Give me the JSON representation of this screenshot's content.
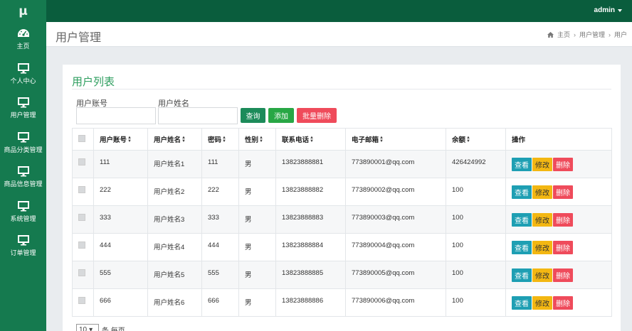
{
  "app": {
    "logo": "μ",
    "user": "admin"
  },
  "sidebar": {
    "items": [
      {
        "label": "主页",
        "icon": "dashboard-gauge-icon"
      },
      {
        "label": "个人中心",
        "icon": "monitor-icon"
      },
      {
        "label": "用户管理",
        "icon": "monitor-icon"
      },
      {
        "label": "商品分类管理",
        "icon": "monitor-icon"
      },
      {
        "label": "商品信息管理",
        "icon": "monitor-icon"
      },
      {
        "label": "系统管理",
        "icon": "monitor-icon"
      },
      {
        "label": "订单管理",
        "icon": "monitor-icon"
      }
    ]
  },
  "header": {
    "title": "用户管理",
    "breadcrumb": [
      "主页",
      "用户管理",
      "用户"
    ]
  },
  "card": {
    "title": "用户列表",
    "search": {
      "account_label": "用户账号",
      "account_value": "",
      "name_label": "用户姓名",
      "name_value": ""
    },
    "buttons": {
      "query": "查询",
      "add": "添加",
      "batch_delete": "批量删除"
    }
  },
  "table": {
    "columns": [
      "用户账号",
      "用户姓名",
      "密码",
      "性别",
      "联系电话",
      "电子邮箱",
      "余额",
      "操作"
    ],
    "rows": [
      {
        "account": "111",
        "name": "用户姓名1",
        "password": "111",
        "gender": "男",
        "phone": "13823888881",
        "email": "773890001@qq.com",
        "balance": "426424992"
      },
      {
        "account": "222",
        "name": "用户姓名2",
        "password": "222",
        "gender": "男",
        "phone": "13823888882",
        "email": "773890002@qq.com",
        "balance": "100"
      },
      {
        "account": "333",
        "name": "用户姓名3",
        "password": "333",
        "gender": "男",
        "phone": "13823888883",
        "email": "773890003@qq.com",
        "balance": "100"
      },
      {
        "account": "444",
        "name": "用户姓名4",
        "password": "444",
        "gender": "男",
        "phone": "13823888884",
        "email": "773890004@qq.com",
        "balance": "100"
      },
      {
        "account": "555",
        "name": "用户姓名5",
        "password": "555",
        "gender": "男",
        "phone": "13823888885",
        "email": "773890005@qq.com",
        "balance": "100"
      },
      {
        "account": "666",
        "name": "用户姓名6",
        "password": "666",
        "gender": "男",
        "phone": "13823888886",
        "email": "773890006@qq.com",
        "balance": "100"
      }
    ],
    "ops": {
      "view": "查看",
      "edit": "修改",
      "delete": "删除"
    }
  },
  "pager": {
    "page_size": "10",
    "suffix": "条 每页"
  },
  "colors": {
    "topbar": "#0a5d3d",
    "sidebar": "#157a4f",
    "accent": "#2e9e5f",
    "query_btn": "#1c8b5a",
    "add_btn": "#28a745",
    "delete_btn": "#ef4b5b",
    "view_btn": "#1e9fb3",
    "edit_btn": "#f3b712"
  }
}
